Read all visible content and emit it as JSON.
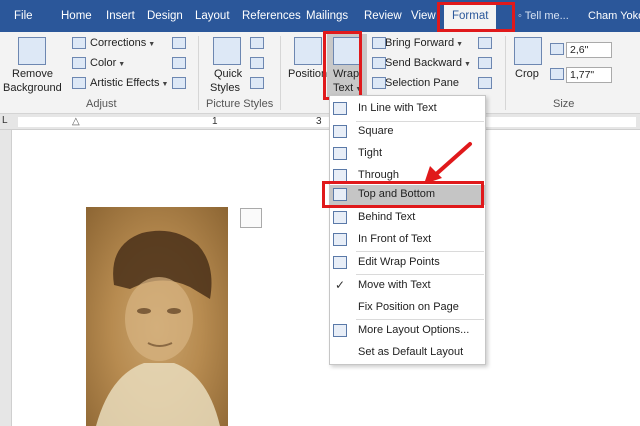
{
  "tabs": [
    "File",
    "Home",
    "Insert",
    "Design",
    "Layout",
    "References",
    "Mailings",
    "Review",
    "View"
  ],
  "active_tab": "Format",
  "tell_me": "Tell me...",
  "user": "Cham Yoko",
  "ribbon": {
    "remove_background": [
      "Remove",
      "Background"
    ],
    "adjust": {
      "corrections": "Corrections",
      "color": "Color",
      "artistic_effects": "Artistic Effects",
      "group_label": "Adjust"
    },
    "quick_styles": [
      "Quick",
      "Styles"
    ],
    "picture_styles_label": "Picture Styles",
    "position": "Position",
    "wrap_text": [
      "Wrap",
      "Text"
    ],
    "bring_forward": "Bring Forward",
    "send_backward": "Send Backward",
    "selection_pane": "Selection Pane",
    "crop": "Crop",
    "height": "2,6\"",
    "width": "1,77\"",
    "size_label": "Size"
  },
  "ruler_marks": [
    "1",
    "3"
  ],
  "wrap_menu": {
    "items": [
      {
        "label": "In Line with Text",
        "icon": "inline-wrap-icon"
      },
      {
        "label": "Square",
        "icon": "square-wrap-icon"
      },
      {
        "label": "Tight",
        "icon": "tight-wrap-icon"
      },
      {
        "label": "Through",
        "icon": "through-wrap-icon"
      },
      {
        "label": "Top and Bottom",
        "icon": "top-bottom-wrap-icon",
        "selected": true
      },
      {
        "label": "Behind Text",
        "icon": "behind-text-icon"
      },
      {
        "label": "In Front of Text",
        "icon": "in-front-text-icon"
      },
      {
        "label": "Edit Wrap Points",
        "icon": "edit-wrap-points-icon"
      },
      {
        "label": "Move with Text",
        "icon": "checkmark-icon",
        "checked": true
      },
      {
        "label": "Fix Position on Page",
        "icon": ""
      },
      {
        "label": "More Layout Options...",
        "icon": "layout-options-icon"
      },
      {
        "label": "Set as Default Layout",
        "icon": ""
      }
    ]
  },
  "colors": {
    "tab_bar": "#2b579a",
    "highlight": "#e0191b",
    "selected_item": "#c5c5c5",
    "photo": "#b78b50"
  }
}
